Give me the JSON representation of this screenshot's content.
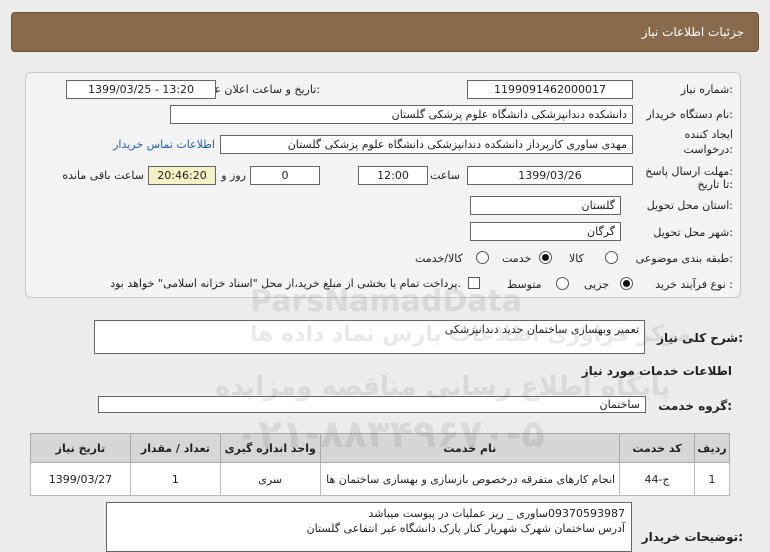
{
  "header": {
    "title": "جزئیات اطلاعات نیاز"
  },
  "fields": {
    "need_number_label": "شماره نیاز:",
    "need_number": "1199091462000017",
    "announce_label": "تاریخ و ساعت اعلان عمومی:",
    "announce_value": "1399/03/25 - 13:20",
    "buyer_label": "نام دستگاه خریدار:",
    "buyer_value": "دانشکده دندانپزشکی دانشگاه علوم پزشکی گلستان",
    "creator_label_1": "ایجاد کننده",
    "creator_label_2": "درخواست:",
    "creator_value": "مهدی ساوری کارپرداز دانشکده دندانپزشکی دانشگاه علوم پزشکی گلستان",
    "contact_link": "اطلاعات تماس خریدار",
    "deadline_label_1": "مهلت ارسال پاسخ:",
    "deadline_label_2": "تا تاریخ:",
    "deadline_date": "1399/03/26",
    "time_label": "ساعت",
    "deadline_time": "12:00",
    "days_value": "0",
    "days_label": "روز و",
    "remaining_value": "20:46:20",
    "remaining_label": "ساعت باقی مانده",
    "province_label": "استان محل تحویل:",
    "province_value": "گلستان",
    "city_label": "شهر محل تحویل:",
    "city_value": "گرگان",
    "category_label": "طبقه بندی موضوعی:",
    "category_options": [
      "کالا",
      "خدمت",
      "کالا/خدمت"
    ],
    "category_selected": "خدمت",
    "process_label": "نوع فرآیند خرید :",
    "process_options": [
      "جزیی",
      "متوسط"
    ],
    "process_selected": "جزیی",
    "payment_note": "پرداخت تمام یا بخشی از مبلغ خرید،از محل \"اسناد خزانه اسلامی\" خواهد بود."
  },
  "summary": {
    "label": "شرح کلی نیاز:",
    "value": "تعمیر وبهسازی ساختمان جدید دندانپزشکی"
  },
  "services": {
    "section_title": "اطلاعات خدمات مورد نیاز",
    "group_label": "گروه خدمت:",
    "group_value": "ساختمان",
    "columns": [
      "ردیف",
      "کد خدمت",
      "نام خدمت",
      "واحد اندازه گیری",
      "تعداد / مقدار",
      "تاریخ نیاز"
    ],
    "rows": [
      {
        "index": "1",
        "code": "ج-44",
        "name": "انجام کارهای متفرقه درخصوص بازسازی و بهسازی ساختمان ها",
        "unit": "سری",
        "qty": "1",
        "date": "1399/03/27"
      }
    ]
  },
  "notes": {
    "label": "توضیحات خریدار:",
    "line1": "09370593987ساوری _ ریز عملیات در پیوست میباشد",
    "line2": "آدرس ساختمان شهرک شهریار کنار پارک دانشگاه غیر انتفاعی گلستان"
  },
  "watermark": {
    "brand": "ParsNamadData",
    "line1": "مرکز فراوری اطلاعات پارس نماد داده ها",
    "line2": "پایگاه اطلاع رسانی مناقصه ومزایده",
    "phone": "۰۲۱-۸۸۳۴۹۶۷۰-۵"
  }
}
